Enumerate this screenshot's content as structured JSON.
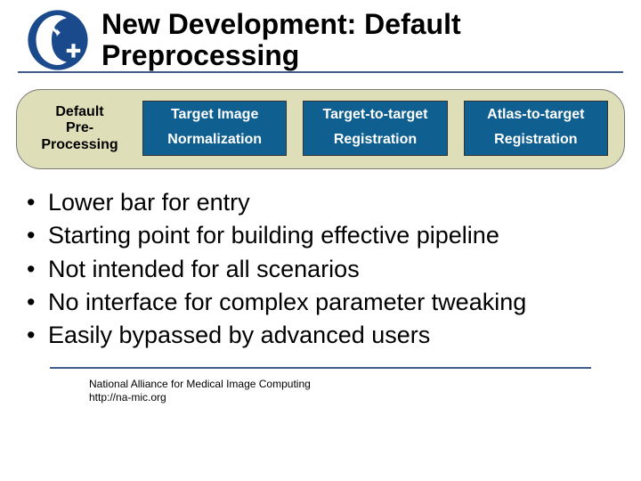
{
  "title": "New Development: Default Preprocessing",
  "pipeline": {
    "label_line1": "Default",
    "label_line2": "Pre-",
    "label_line3": "Processing",
    "stages": [
      {
        "top": "Target Image",
        "bottom": "Normalization"
      },
      {
        "top": "Target-to-target",
        "bottom": "Registration"
      },
      {
        "top": "Atlas-to-target",
        "bottom": "Registration"
      }
    ]
  },
  "bullets": [
    "Lower bar for entry",
    "Starting point for building effective pipeline",
    "Not intended for all scenarios",
    "No interface for complex parameter tweaking",
    "Easily bypassed by advanced users"
  ],
  "footer": {
    "line1": "National Alliance for Medical Image Computing",
    "line2": "http://na-mic.org"
  }
}
